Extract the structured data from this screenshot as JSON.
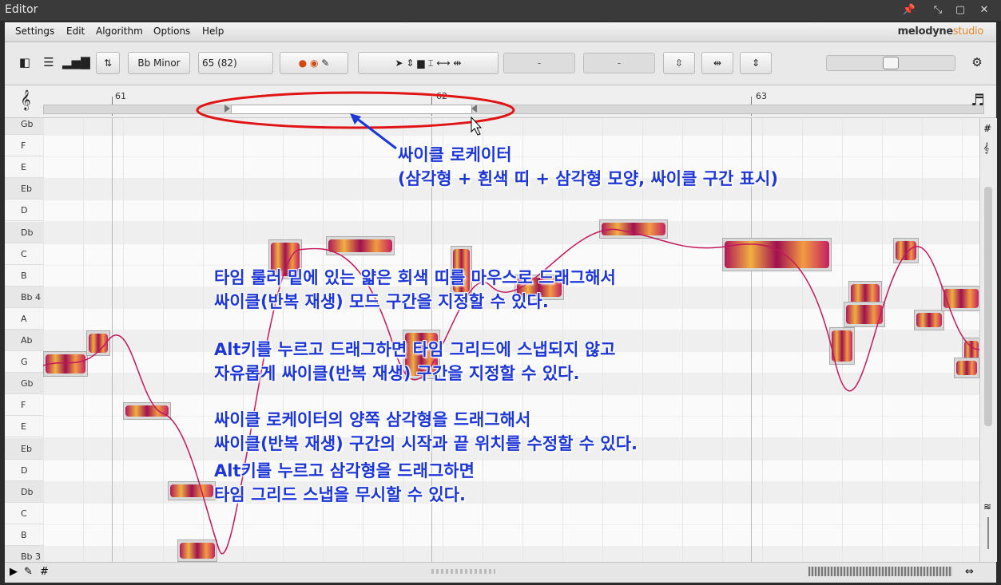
{
  "window": {
    "title": "Editor"
  },
  "menu": {
    "items": [
      "Settings",
      "Edit",
      "Algorithm",
      "Options",
      "Help"
    ],
    "logo_main": "melodyne",
    "logo_sub": "studio"
  },
  "toolbar": {
    "key_label": "Bb Minor",
    "tempo_value": "65 (82)",
    "field1": "-",
    "field2": "-"
  },
  "ruler": {
    "bars": [
      "61",
      "62",
      "63"
    ]
  },
  "keys": [
    "Gb",
    "F",
    "E",
    "Eb",
    "D",
    "Db",
    "C",
    "B",
    "Bb 4",
    "A",
    "Ab",
    "G",
    "Gb",
    "F",
    "E",
    "Eb",
    "D",
    "Db",
    "C",
    "B",
    "Bb 3"
  ],
  "annotations": {
    "cycle_title": "싸이클 로케이터",
    "cycle_desc": "(삼각형 + 흰색 띠 + 삼각형 모양, 싸이클 구간 표시)",
    "p1_l1": "타임 룰러 밑에 있는 얇은 회색 띠를 마우스로 드래그해서",
    "p1_l2": "싸이클(반복 재생) 모드 구간을 지정할 수 있다.",
    "p2_alt": "Alt",
    "p2_l1": "키를 누르고 드래그하면 타임 그리드에 스냅되지 않고",
    "p2_l2": "자유롭게 싸이클(반복 재생) 구간을 지정할 수 있다.",
    "p3_l1": "싸이클 로케이터의 양쪽 삼각형을 드래그해서",
    "p3_l2": "싸이클(반복 재생) 구간의 시작과 끝 위치를 수정할 수 있다.",
    "p4_alt": "Alt",
    "p4_l1": "키를 누르고 삼각형을 드래그하면",
    "p4_l2": "타임 그리드 스냅을 무시할 수 있다."
  },
  "colors": {
    "annotation": "#1d36d6",
    "highlight_ellipse": "#e01414",
    "note_blob": "#c32060"
  }
}
